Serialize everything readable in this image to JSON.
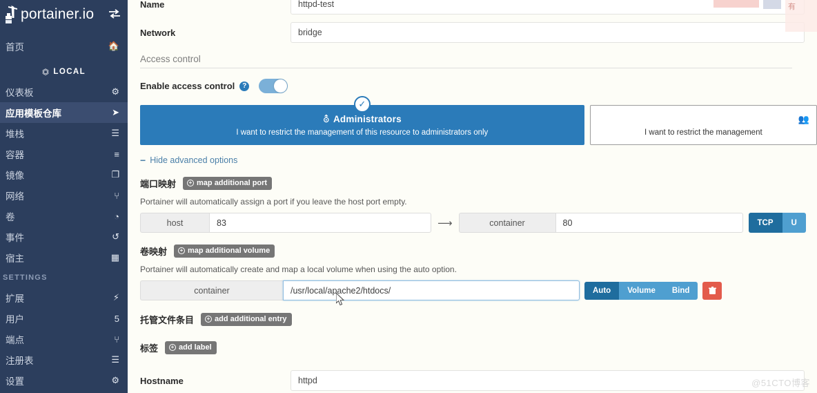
{
  "sidebar": {
    "brand": "portainer.io",
    "toggle_icon": "collapse-arrows-icon",
    "home": {
      "label": "首页",
      "icon": "home-icon"
    },
    "environment": {
      "label": "LOCAL",
      "icon": "plug-icon"
    },
    "items": [
      {
        "label": "仪表板",
        "icon": "dashboard-icon",
        "active": false
      },
      {
        "label": "应用模板仓库",
        "icon": "rocket-icon",
        "active": true
      },
      {
        "label": "堆栈",
        "icon": "stacks-icon",
        "active": false
      },
      {
        "label": "容器",
        "icon": "containers-icon",
        "active": false
      },
      {
        "label": "镜像",
        "icon": "images-icon",
        "active": false
      },
      {
        "label": "网络",
        "icon": "network-icon",
        "active": false
      },
      {
        "label": "卷",
        "icon": "volumes-icon",
        "active": false
      },
      {
        "label": "事件",
        "icon": "events-icon",
        "active": false
      },
      {
        "label": "宿主",
        "icon": "host-icon",
        "active": false
      }
    ],
    "settings_section": "SETTINGS",
    "settings_items": [
      {
        "label": "扩展",
        "icon": "bolt-icon"
      },
      {
        "label": "用户",
        "icon": "users-icon"
      },
      {
        "label": "端点",
        "icon": "endpoint-plug-icon"
      },
      {
        "label": "注册表",
        "icon": "registry-database-icon"
      },
      {
        "label": "设置",
        "icon": "gears-icon"
      }
    ]
  },
  "form": {
    "name_label": "Name",
    "name_value": "httpd-test",
    "network_label": "Network",
    "network_value": "bridge"
  },
  "access_control": {
    "section_title": "Access control",
    "enable_label": "Enable access control",
    "help_icon": "question-mark-icon",
    "toggle_on": true,
    "admin_card": {
      "icon": "ninja-icon",
      "title": "Administrators",
      "subtitle": "I want to restrict the management of this resource to administrators only",
      "check_icon": "check-icon",
      "selected": true
    },
    "restricted_card": {
      "icon": "add-users-icon",
      "subtitle": "I want to restrict the management"
    }
  },
  "advanced": {
    "toggle_label": "Hide advanced options",
    "toggle_icon": "minus-icon"
  },
  "ports": {
    "label": "端口映射",
    "add_button": "map additional port",
    "add_icon": "plus-circle-icon",
    "hint": "Portainer will automatically assign a port if you leave the host port empty.",
    "host_addon": "host",
    "host_value": "83",
    "arrow_icon": "arrow-right-icon",
    "container_addon": "container",
    "container_value": "80",
    "protocols": [
      {
        "label": "TCP",
        "selected": true
      },
      {
        "label": "U",
        "selected": false
      }
    ]
  },
  "volumes": {
    "label": "卷映射",
    "add_button": "map additional volume",
    "add_icon": "plus-circle-icon",
    "hint": "Portainer will automatically create and map a local volume when using the auto option.",
    "container_addon": "container",
    "path_value": "/usr/local/apache2/htdocs/",
    "modes": [
      {
        "label": "Auto",
        "selected": true
      },
      {
        "label": "Volume",
        "selected": false
      },
      {
        "label": "Bind",
        "selected": false
      }
    ],
    "delete_icon": "trash-icon"
  },
  "files": {
    "label": "托管文件条目",
    "add_button": "add additional entry",
    "add_icon": "plus-circle-icon"
  },
  "labels": {
    "label": "标签",
    "add_button": "add label",
    "add_icon": "plus-circle-icon"
  },
  "hostname": {
    "label": "Hostname",
    "value": "httpd"
  },
  "watermark": "@51CTO博客",
  "colors": {
    "sidebar_bg": "#2c3e5d",
    "sidebar_active": "#3b4d70",
    "accent_blue": "#2b7bb9",
    "segment_blue": "#4f9fd0",
    "segment_selected": "#1f6d9e",
    "danger_red": "#e35b4c",
    "page_bg": "#fdfdf7"
  }
}
